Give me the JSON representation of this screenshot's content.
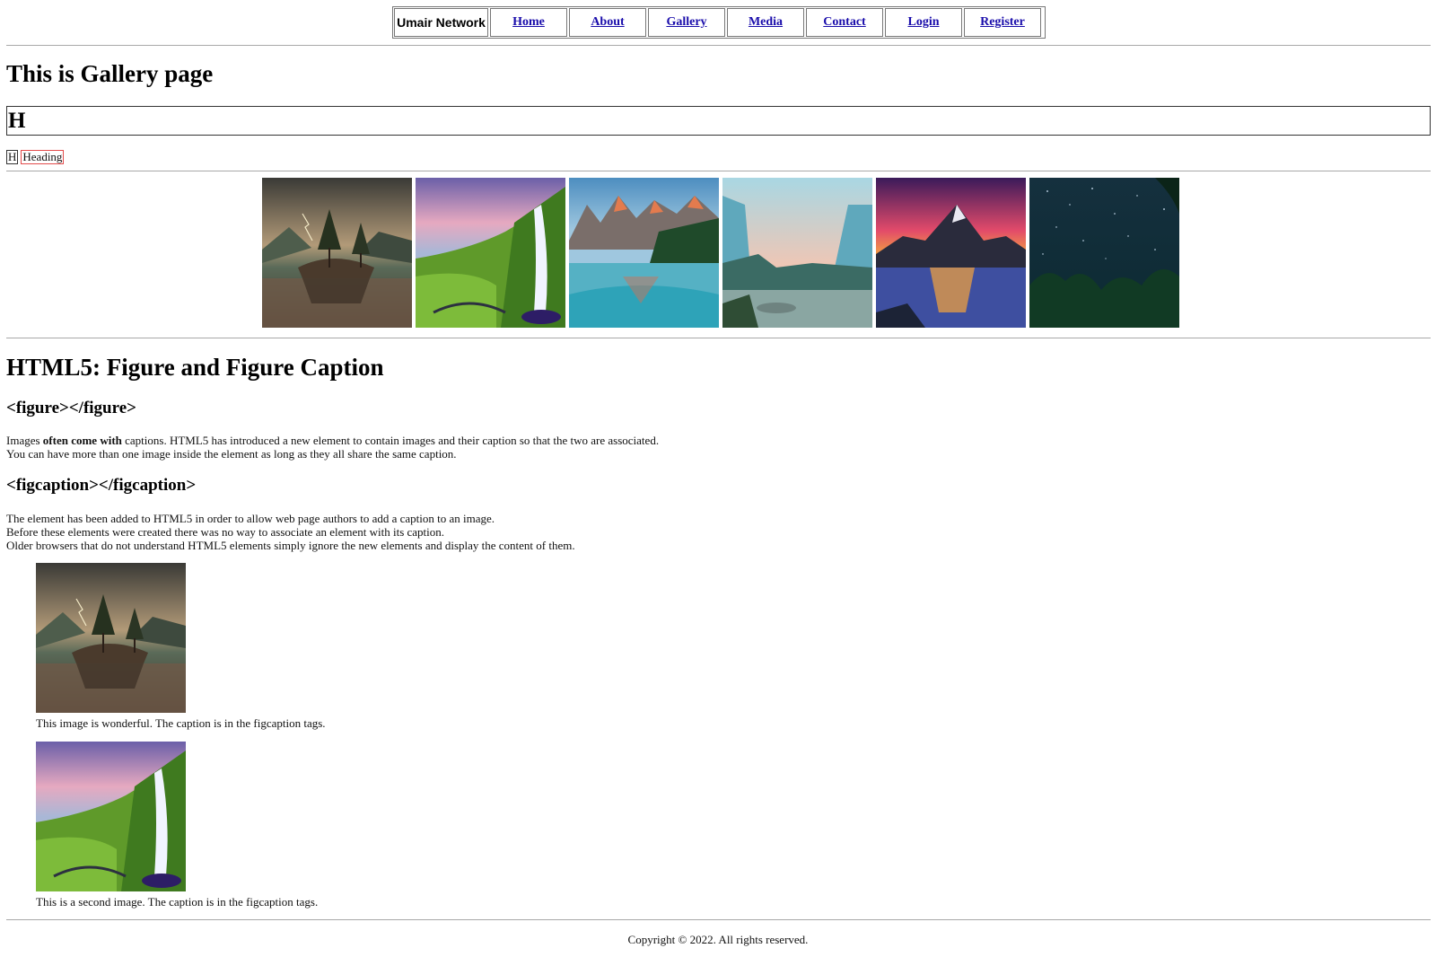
{
  "nav": {
    "brand": "Umair Network",
    "links": [
      "Home",
      "About",
      "Gallery",
      "Media",
      "Contact",
      "Login",
      "Register"
    ]
  },
  "page_title": "This is Gallery page",
  "search_input": {
    "value": "H"
  },
  "sample": {
    "h": "H",
    "heading": "Heading"
  },
  "gallery": {
    "images": [
      {
        "name": "lake-tree-storm-image"
      },
      {
        "name": "waterfall-image"
      },
      {
        "name": "mountain-lake-image"
      },
      {
        "name": "misty-valley-image"
      },
      {
        "name": "sunset-mountain-image"
      },
      {
        "name": "starry-forest-image"
      }
    ]
  },
  "section": {
    "title": "HTML5: Figure and Figure Caption",
    "figure_tag": "<figure></figure>",
    "figure_para": {
      "pre": "Images ",
      "bold": "often come with",
      "post": " captions. HTML5 has introduced a new element to contain images and their caption so that the two are associated.",
      "line2": "You can have more than one image inside the element as long as they all share the same caption."
    },
    "figcaption_tag": "<figcaption></figcaption>",
    "figcaption_para": {
      "line1": "The element has been added to HTML5 in order to allow web page authors to add a caption to an image.",
      "line2": "Before these elements were created there was no way to associate an element with its caption.",
      "line3": "Older browsers that do not understand HTML5 elements simply ignore the new elements and display the content of them."
    }
  },
  "figures": [
    {
      "caption": "This image is wonderful. The caption is in the figcaption tags."
    },
    {
      "caption": "This is a second image. The caption is in the figcaption tags."
    }
  ],
  "footer": "Copyright © 2022. All rights reserved."
}
